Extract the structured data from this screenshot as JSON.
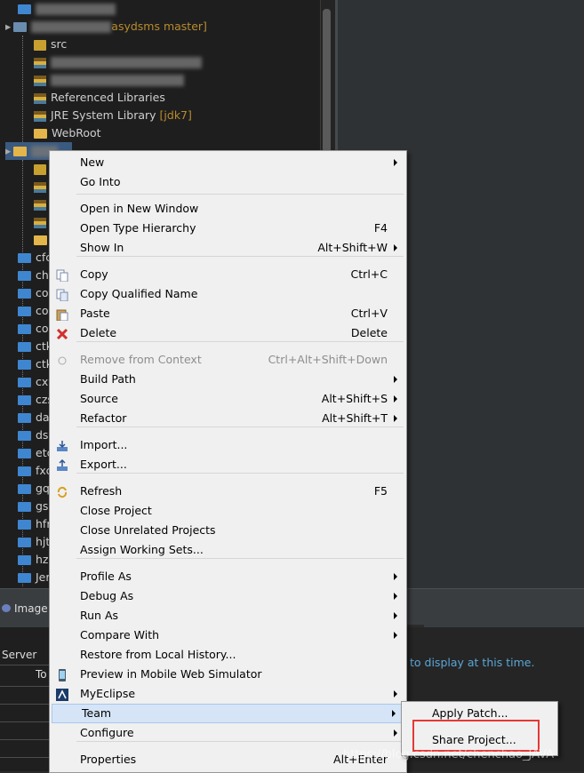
{
  "tree": {
    "project_suffix": "asydsms master]",
    "items": [
      {
        "label": "src"
      },
      {
        "label": "Referenced Libraries"
      },
      {
        "label": "JRE System Library",
        "tag": "[jdk7]"
      },
      {
        "label": "WebRoot"
      }
    ],
    "folders": [
      "cfc",
      "chl",
      "co",
      "co",
      "co",
      "ctk",
      "ctk",
      "cxy",
      "czs",
      "da",
      "ds",
      "etc",
      "fxc",
      "gq",
      "gs",
      "hfr",
      "hjt",
      "hzp",
      "Jer"
    ]
  },
  "bottom": {
    "images_tab": "Image",
    "server_header": "Server",
    "server_row": "To",
    "message": "to display at this time."
  },
  "menu": {
    "items": [
      {
        "label": "New",
        "shortcut": "",
        "submenu": true
      },
      {
        "label": "Go Into",
        "shortcut": ""
      },
      {
        "label": "Open in New Window",
        "shortcut": ""
      },
      {
        "label": "Open Type Hierarchy",
        "shortcut": "F4"
      },
      {
        "label": "Show In",
        "shortcut": "Alt+Shift+W",
        "submenu": true
      },
      {
        "label": "Copy",
        "shortcut": "Ctrl+C",
        "icon": "copy-icon"
      },
      {
        "label": "Copy Qualified Name",
        "shortcut": "",
        "icon": "copy-qualified-icon"
      },
      {
        "label": "Paste",
        "shortcut": "Ctrl+V",
        "icon": "paste-icon"
      },
      {
        "label": "Delete",
        "shortcut": "Delete",
        "icon": "delete-icon"
      },
      {
        "label": "Remove from Context",
        "shortcut": "Ctrl+Alt+Shift+Down",
        "disabled": true,
        "icon": "remove-context-icon"
      },
      {
        "label": "Build Path",
        "shortcut": "",
        "submenu": true
      },
      {
        "label": "Source",
        "shortcut": "Alt+Shift+S",
        "submenu": true
      },
      {
        "label": "Refactor",
        "shortcut": "Alt+Shift+T",
        "submenu": true
      },
      {
        "label": "Import...",
        "shortcut": "",
        "icon": "import-icon"
      },
      {
        "label": "Export...",
        "shortcut": "",
        "icon": "export-icon"
      },
      {
        "label": "Refresh",
        "shortcut": "F5",
        "icon": "refresh-icon"
      },
      {
        "label": "Close Project",
        "shortcut": ""
      },
      {
        "label": "Close Unrelated Projects",
        "shortcut": ""
      },
      {
        "label": "Assign Working Sets...",
        "shortcut": ""
      },
      {
        "label": "Profile As",
        "shortcut": "",
        "submenu": true
      },
      {
        "label": "Debug As",
        "shortcut": "",
        "submenu": true
      },
      {
        "label": "Run As",
        "shortcut": "",
        "submenu": true
      },
      {
        "label": "Compare With",
        "shortcut": "",
        "submenu": true
      },
      {
        "label": "Restore from Local History...",
        "shortcut": ""
      },
      {
        "label": "Preview in Mobile Web Simulator",
        "shortcut": "",
        "icon": "mobile-icon"
      },
      {
        "label": "MyEclipse",
        "shortcut": "",
        "submenu": true,
        "icon": "myeclipse-icon"
      },
      {
        "label": "Team",
        "shortcut": "",
        "submenu": true,
        "highlighted": true
      },
      {
        "label": "Configure",
        "shortcut": "",
        "submenu": true
      },
      {
        "label": "Properties",
        "shortcut": "Alt+Enter"
      }
    ]
  },
  "submenu": {
    "items": [
      {
        "label": "Apply Patch..."
      },
      {
        "label": "Share Project..."
      }
    ]
  },
  "watermark": "https://blog.csdn.net/chenchao_JAVA",
  "colors": {
    "highlight": "#d5e5f7",
    "annotation": "#e53935",
    "accent": "#3f86d0"
  }
}
